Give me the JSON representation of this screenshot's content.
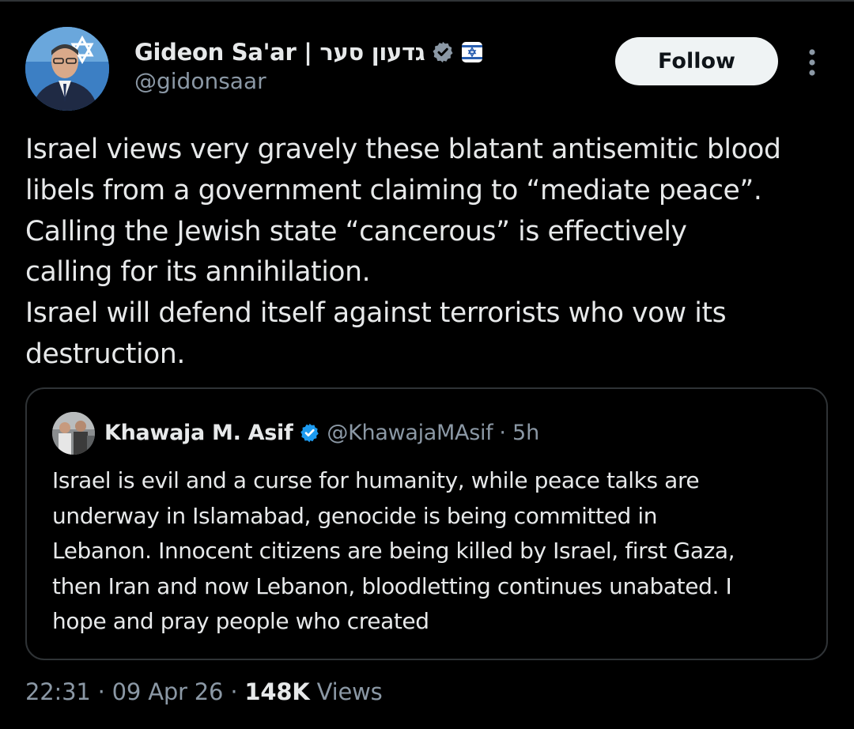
{
  "author": {
    "display_name": "Gideon Sa'ar | גדעון סער",
    "handle": "@gidonsaar",
    "verified_badge_color": "#1d9bf0",
    "affiliation_icon": "flag-badge-icon"
  },
  "follow_button": {
    "label": "Follow"
  },
  "more_button": {
    "icon": "more-vertical-icon"
  },
  "tweet": {
    "lines": [
      "Israel views very gravely these blatant antisemitic blood",
      "libels from a government claiming to “mediate peace”.",
      "Calling the Jewish state “cancerous” is effectively",
      "calling for its annihilation.",
      "Israel will defend itself against terrorists who vow its",
      "destruction."
    ]
  },
  "quoted_tweet": {
    "display_name": "Khawaja M. Asif",
    "handle": "@KhawajaMAsif",
    "separator": "·",
    "time": "5h",
    "verified_badge_color": "#1d9bf0",
    "lines": [
      "Israel is evil and a curse for humanity, while peace talks are",
      "underway in Islamabad, genocide is being committed in",
      "Lebanon. Innocent citizens are being killed by Israel, first Gaza,",
      "then Iran and now Lebanon, bloodletting continues unabated. I",
      "hope and pray people who created"
    ]
  },
  "meta": {
    "time": "22:31",
    "separator": "·",
    "date": "09 Apr 26",
    "views_count": "148K",
    "views_label": "Views"
  },
  "colors": {
    "background": "#000000",
    "text_primary": "#e7e9ea",
    "text_secondary": "#8b98a5",
    "border": "#2f3336",
    "follow_bg": "#eff3f4"
  }
}
